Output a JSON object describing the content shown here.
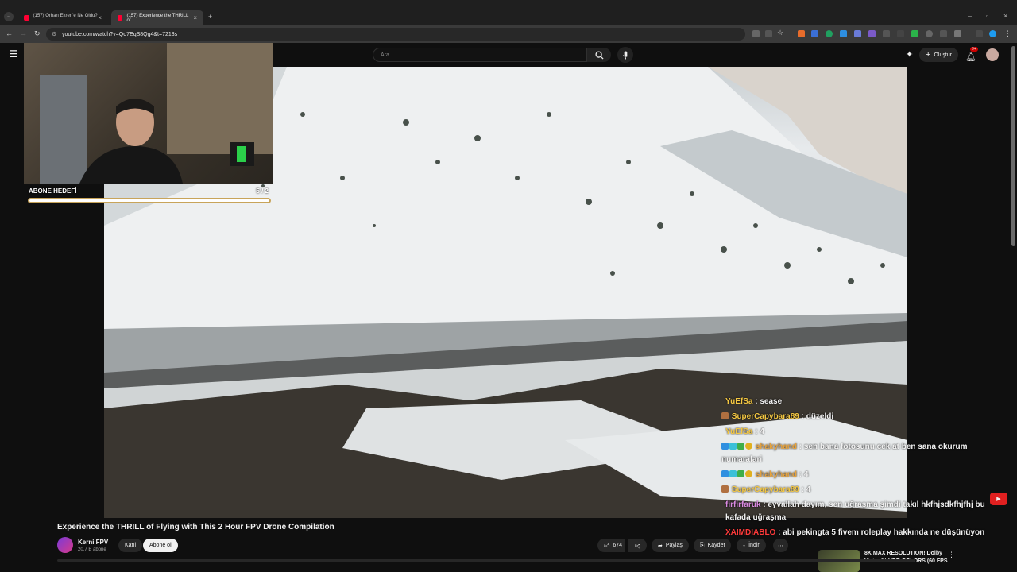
{
  "browser": {
    "tabs": [
      {
        "title": "(157) Orhan Ekren'e Ne Oldu? ..."
      },
      {
        "title": "(157) Experience the THRILL of ..."
      }
    ],
    "url": "youtube.com/watch?v=Qo7EqS8Qg4&t=7213s"
  },
  "youtube": {
    "search_placeholder": "Ara",
    "create_label": "Oluştur",
    "notification_count": "9+"
  },
  "overlay": {
    "subscriber_goal_label": "ABONE HEDEFİ",
    "subscriber_goal_value": "5  / 2",
    "subscriber_goal_progress": 1.0
  },
  "chat": [
    {
      "user": "YuEfSa",
      "text": "sease",
      "user_color": "#f5c842"
    },
    {
      "user": "SuperCapybara89",
      "text": "düzeldi",
      "user_color": "#f5c842"
    },
    {
      "user": "YuEfSa",
      "text": "4",
      "user_color": "#f5c842"
    },
    {
      "user": "shakyhand",
      "text": "sen bana fotosunu cek at ben sana okurum numaralari",
      "user_color": "#e8a33c"
    },
    {
      "user": "shakyhand",
      "text": "4",
      "user_color": "#e8a33c"
    },
    {
      "user": "SuperCapybara89",
      "text": "4",
      "user_color": "#f5c842"
    },
    {
      "user": "firfirfaruk",
      "text": "eyvallah dayım, sen uğraşma şimdi takıl hkfhjsdkfhjfhj bu kafada uğraşma",
      "user_color": "#d98ae0"
    },
    {
      "user": "XAIMDIABLO",
      "text": "abi pekingta 5 fivem roleplay hakkında ne düşünüyon",
      "user_color": "#ff3b3b"
    }
  ],
  "video": {
    "title": "Experience the THRILL of Flying with This 2 Hour FPV Drone Compilation",
    "channel": "Kerni FPV",
    "subscribers": "20,7 B abone",
    "join_label": "Katıl",
    "subscribe_label": "Abone ol",
    "likes": "674",
    "share_label": "Paylaş",
    "save_label": "Kaydet",
    "download_label": "İndir"
  },
  "recommended": {
    "title_line1": "8K MAX RESOLUTION! Dolby",
    "title_line2": "Vision™ HDR COLORS (60 FPS"
  },
  "colors": {
    "youtube_red": "#ff0033",
    "goal_border": "#c8a45a"
  }
}
